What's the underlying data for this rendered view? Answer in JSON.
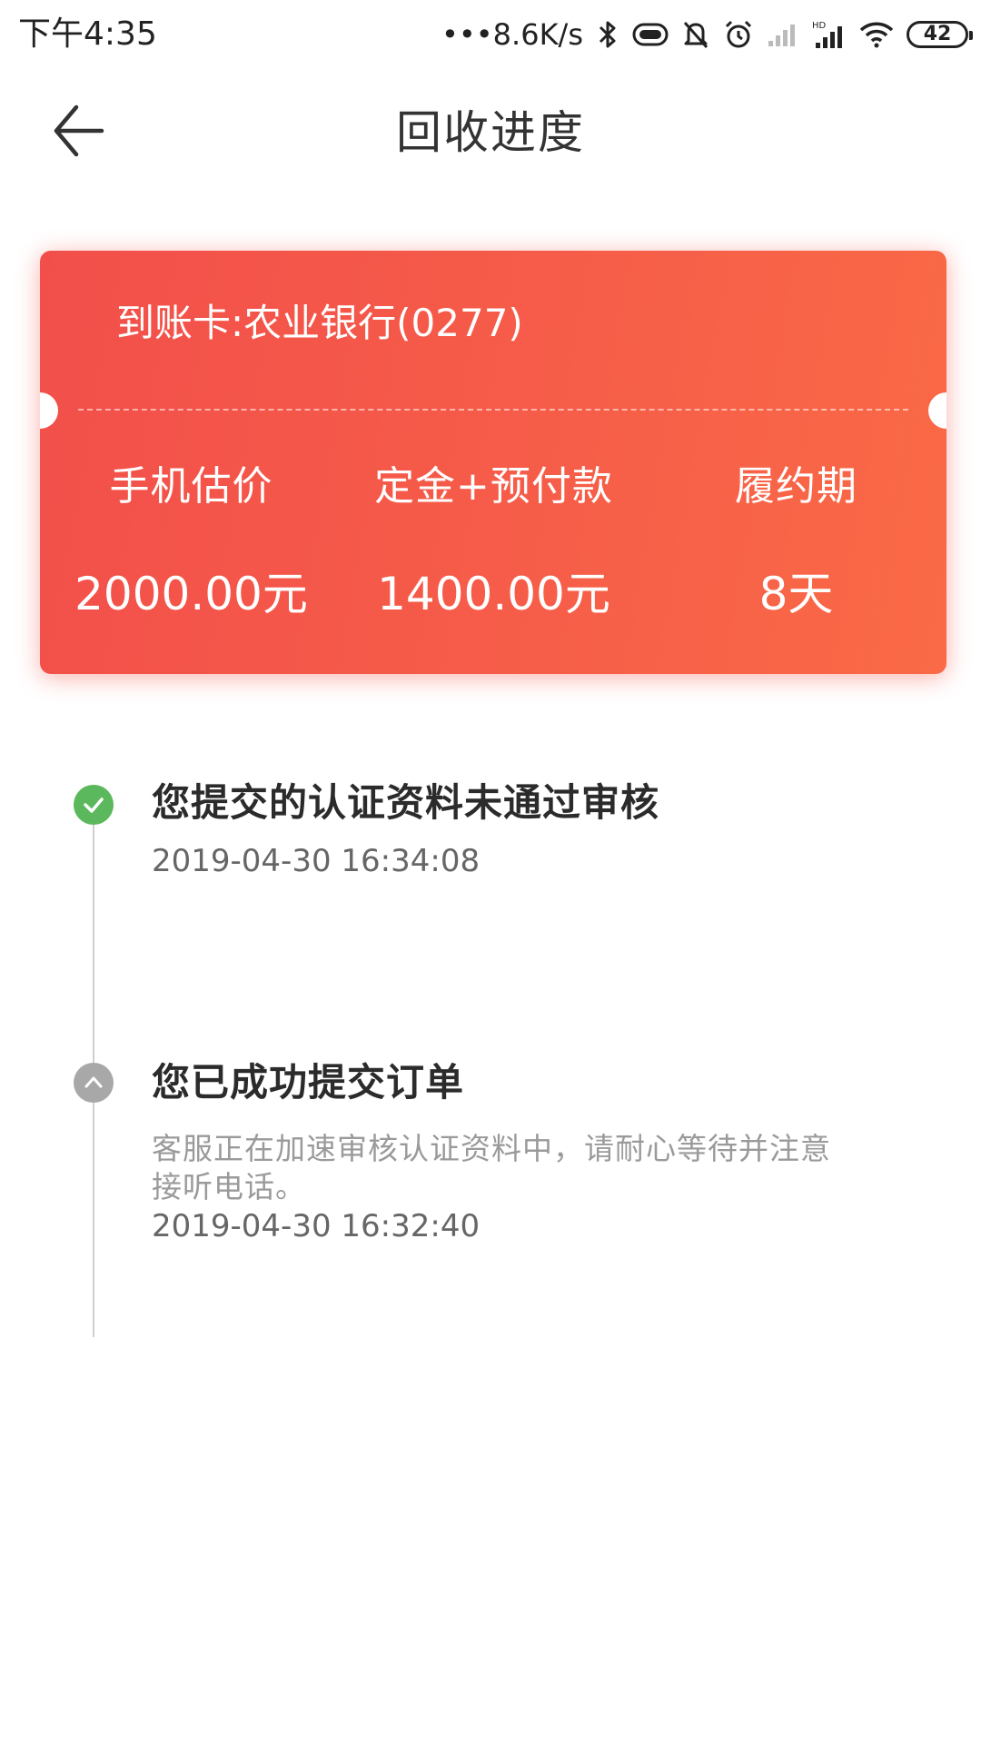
{
  "status_bar": {
    "time": "下午4:35",
    "network_speed": "•••8.6K/s",
    "battery_level": "42",
    "icons": [
      "bluetooth-icon",
      "vibrate-icon",
      "mute-icon",
      "alarm-icon",
      "signal-weak-icon",
      "signal-hd-icon",
      "wifi-icon",
      "battery-icon"
    ]
  },
  "nav": {
    "title": "回收进度",
    "back_icon": "back-arrow-icon"
  },
  "card": {
    "account": "到账卡:农业银行(0277)",
    "columns": [
      {
        "label": "手机估价",
        "value": "2000.00元"
      },
      {
        "label": "定金+预付款",
        "value": "1400.00元"
      },
      {
        "label": "履约期",
        "value": "8天"
      }
    ],
    "colors": {
      "start": "#f24f4a",
      "end": "#fa6a46"
    }
  },
  "timeline": {
    "items": [
      {
        "title": "您提交的认证资料未通过审核",
        "time": "2019-04-30 16:34:08",
        "status": "success",
        "icon": "check-icon",
        "color": "#5cb85c"
      },
      {
        "title": "您已成功提交订单",
        "desc_line1": "客服正在加速审核认证资料中，请耐心等待并注意",
        "desc_line2": "接听电话。",
        "time": "2019-04-30 16:32:40",
        "status": "pending",
        "icon": "chevron-up-icon",
        "color": "#a8a8a8"
      }
    ]
  }
}
